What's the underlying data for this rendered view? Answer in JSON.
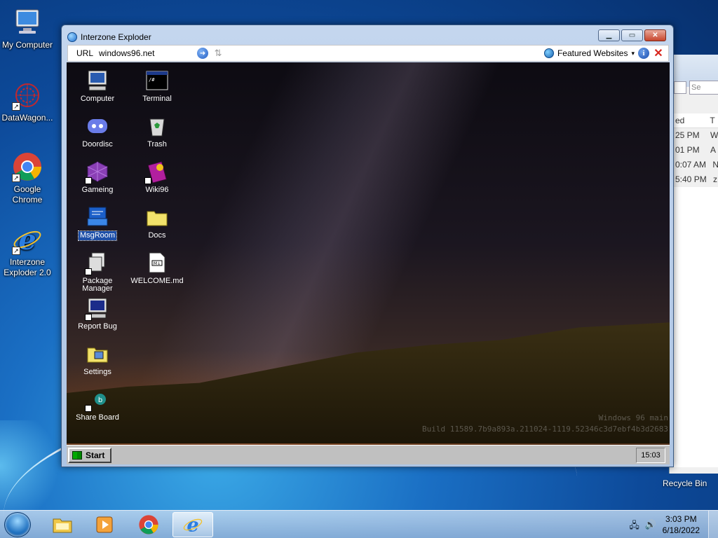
{
  "desktop": {
    "icons": [
      {
        "label": "My Computer",
        "icon": "computer-icon"
      },
      {
        "label": "DataWagon...",
        "icon": "datawagon-icon"
      },
      {
        "label": "Google Chrome",
        "icon": "chrome-icon"
      },
      {
        "label": "Interzone Exploder 2.0",
        "icon": "ie-icon"
      }
    ],
    "recycle_bin": "Recycle Bin"
  },
  "background_window": {
    "search_placeholder": "Se",
    "header_fragment": "ed",
    "header_fragment2": "T",
    "rows": [
      {
        "time": "25 PM",
        "c": "W"
      },
      {
        "time": "01 PM",
        "c": "A"
      },
      {
        "time": "0:07 AM",
        "c": "N"
      },
      {
        "time": "5:40 PM",
        "c": "z"
      }
    ]
  },
  "browser": {
    "title": "Interzone Exploder",
    "url_label": "URL",
    "url_value": "windows96.net",
    "featured_label": "Featured Websites",
    "featured_caret": "▾"
  },
  "win96": {
    "icons": [
      {
        "label": "Computer",
        "icon": "computer-icon"
      },
      {
        "label": "Terminal",
        "icon": "terminal-icon"
      },
      {
        "label": "Doordisc",
        "icon": "doordisc-icon"
      },
      {
        "label": "Trash",
        "icon": "trash-icon"
      },
      {
        "label": "Gameing",
        "icon": "gameing-icon"
      },
      {
        "label": "Wiki96",
        "icon": "wiki-icon"
      },
      {
        "label": "MsgRoom",
        "icon": "msgroom-icon"
      },
      {
        "label": "Docs",
        "icon": "folder-icon"
      },
      {
        "label": "Package Manager",
        "icon": "package-icon"
      },
      {
        "label": "WELCOME.md",
        "icon": "markdown-file-icon"
      },
      {
        "label": "Report Bug",
        "icon": "report-bug-icon"
      },
      {
        "label": "Settings",
        "icon": "settings-icon"
      },
      {
        "label": "Share Board",
        "icon": "share-board-icon"
      }
    ],
    "watermark_line1": "Windows 96 main",
    "watermark_line2": "Build 11589.7b9a893a.211024-1119.52346c3d7ebf4b3d2683",
    "start_label": "Start",
    "clock": "15:03"
  },
  "taskbar": {
    "time": "3:03 PM",
    "date": "6/18/2022",
    "apps": [
      "explorer-icon",
      "media-player-icon",
      "chrome-icon",
      "ie-icon"
    ]
  }
}
